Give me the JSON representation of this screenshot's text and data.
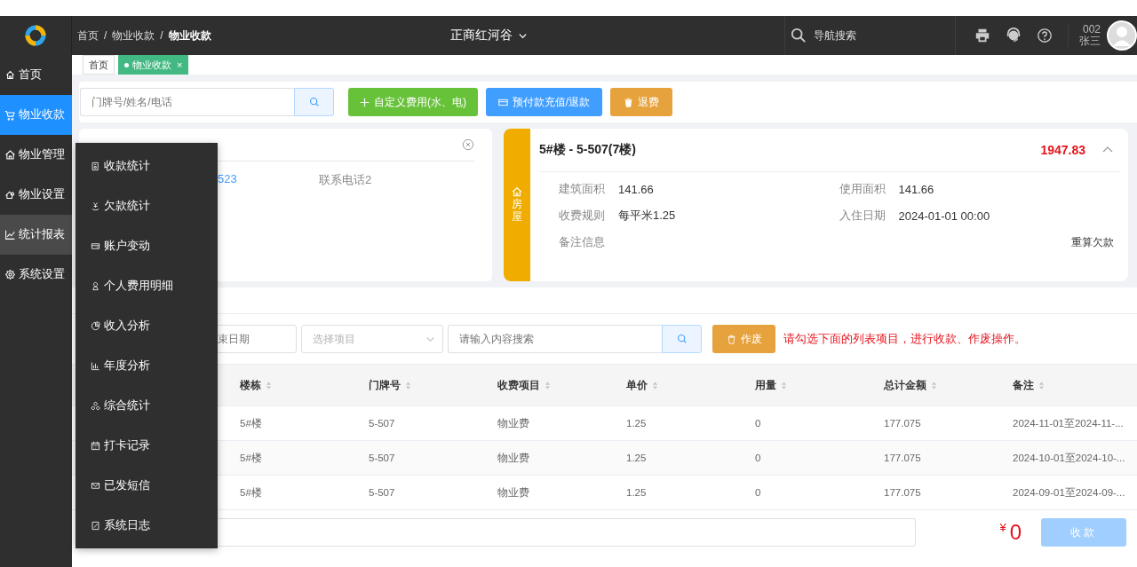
{
  "header": {
    "breadcrumb": [
      {
        "label": "首页"
      },
      {
        "separator": "/",
        "label": "物业收款"
      },
      {
        "separator": "/",
        "label": "物业收款"
      }
    ],
    "community": "正商红河谷",
    "search_label": "导航搜索",
    "user_code": "002",
    "user_name": "张三"
  },
  "sidebar": {
    "items": [
      {
        "label": "首页",
        "selected": false,
        "hover": false
      },
      {
        "label": "物业收款",
        "selected": true,
        "hover": false
      },
      {
        "label": "物业管理",
        "selected": false,
        "hover": false
      },
      {
        "label": "物业设置",
        "selected": false,
        "hover": false
      },
      {
        "label": "统计报表",
        "selected": false,
        "hover": true
      },
      {
        "label": "系统设置",
        "selected": false,
        "hover": false
      }
    ]
  },
  "submenu": {
    "items": [
      {
        "label": "收款统计"
      },
      {
        "label": "欠款统计"
      },
      {
        "label": "账户变动"
      },
      {
        "label": "个人费用明细"
      },
      {
        "label": "收入分析"
      },
      {
        "label": "年度分析"
      },
      {
        "label": "综合统计"
      },
      {
        "label": "打卡记录"
      },
      {
        "label": "已发短信"
      },
      {
        "label": "系统日志"
      }
    ]
  },
  "tabs": [
    {
      "label": "首页",
      "selected": false
    },
    {
      "label": "物业收款",
      "selected": true,
      "close": "×"
    }
  ],
  "toolbar": {
    "search_placeholder": "门牌号/姓名/电话",
    "buttons": [
      {
        "label": "自定义费用(水、电)",
        "kind": "add"
      },
      {
        "label": "预付款充值/退款",
        "kind": "prepay"
      },
      {
        "label": "退费",
        "kind": "refund"
      }
    ]
  },
  "owner_card": {
    "phone_fragment": "523",
    "phone2_label": "联系电话2"
  },
  "house_card": {
    "badge": "房屋",
    "title": "5#楼 - 5-507(7楼)",
    "amount": "1947.83",
    "expanded": true,
    "fields": [
      {
        "label": "建筑面积",
        "value": "141.66"
      },
      {
        "label": "使用面积",
        "value": "141.66"
      },
      {
        "label": "收费规则",
        "value": "每平米1.25"
      },
      {
        "label": "入住日期",
        "value": "2024-01-01 00:00"
      },
      {
        "label": "备注信息"
      }
    ],
    "action": "重算欠款"
  },
  "filters": {
    "date_placeholder": "束日期",
    "select_placeholder": "选择项目",
    "search_placeholder": "请输入内容搜索",
    "void_button": "作废",
    "hint": "请勾选下面的列表项目，进行收款、作废操作。"
  },
  "table": {
    "columns": [
      "楼栋",
      "门牌号",
      "收费项目",
      "单价",
      "用量",
      "总计金额",
      "备注"
    ],
    "rows": [
      [
        "5#楼",
        "5-507",
        "物业费",
        "1.25",
        "0",
        "177.075",
        "2024-11-01至2024-11-..."
      ],
      [
        "5#楼",
        "5-507",
        "物业费",
        "1.25",
        "0",
        "177.075",
        "2024-10-01至2024-10-..."
      ],
      [
        "5#楼",
        "5-507",
        "物业费",
        "1.25",
        "0",
        "177.075",
        "2024-09-01至2024-09-..."
      ]
    ]
  },
  "footer": {
    "currency": "¥",
    "total": "0",
    "pay_button": "收款",
    "pay_disabled": true
  }
}
